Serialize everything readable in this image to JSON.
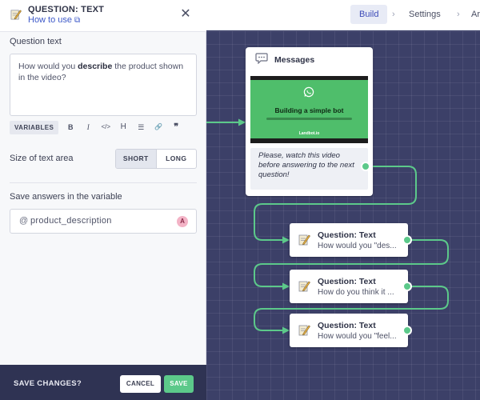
{
  "panel": {
    "header": {
      "title": "QUESTION: TEXT",
      "how_to_use": "How to use",
      "close_icon": "close-icon"
    },
    "question_text_label": "Question text",
    "question_text": {
      "before": "How would you ",
      "bold": "describe",
      "after": " the product shown in the video?"
    },
    "toolbar": {
      "variables": "VARIABLES",
      "buttons": [
        {
          "name": "bold-button",
          "glyph": "B"
        },
        {
          "name": "italic-button",
          "glyph": "I"
        },
        {
          "name": "code-button",
          "glyph": "</>"
        },
        {
          "name": "heading-button",
          "glyph": "H"
        },
        {
          "name": "list-button",
          "glyph": "☰"
        },
        {
          "name": "link-button",
          "glyph": "🔗"
        },
        {
          "name": "quote-button",
          "glyph": "❞"
        }
      ]
    },
    "size_label": "Size of text area",
    "size_options": {
      "short": "SHORT",
      "long": "LONG",
      "selected": "SHORT"
    },
    "save_variable_label": "Save answers in the variable",
    "variable": {
      "prefix": "@",
      "value": "product_description",
      "badge": "A"
    }
  },
  "footer": {
    "label": "SAVE CHANGES?",
    "cancel": "CANCEL",
    "save": "SAVE"
  },
  "topbar": {
    "crumbs": [
      "Build",
      "Settings",
      "Ar"
    ],
    "active": "Build",
    "separator": "›"
  },
  "canvas": {
    "messages_card": {
      "title": "Messages",
      "video_title": "Building a simple bot",
      "video_brand": "Landbot.io",
      "text": "Please, watch this video before answering to the next question!"
    },
    "question_nodes": [
      {
        "title": "Question: Text",
        "subtitle": "How would you \"des..."
      },
      {
        "title": "Question: Text",
        "subtitle": "How do you think it ..."
      },
      {
        "title": "Question: Text",
        "subtitle": "How would you \"feel..."
      }
    ]
  },
  "colors": {
    "accent_green": "#5cc98a",
    "canvas_bg": "#3c4068",
    "footer_bg": "#2f3353",
    "link_blue": "#3d59c9"
  }
}
